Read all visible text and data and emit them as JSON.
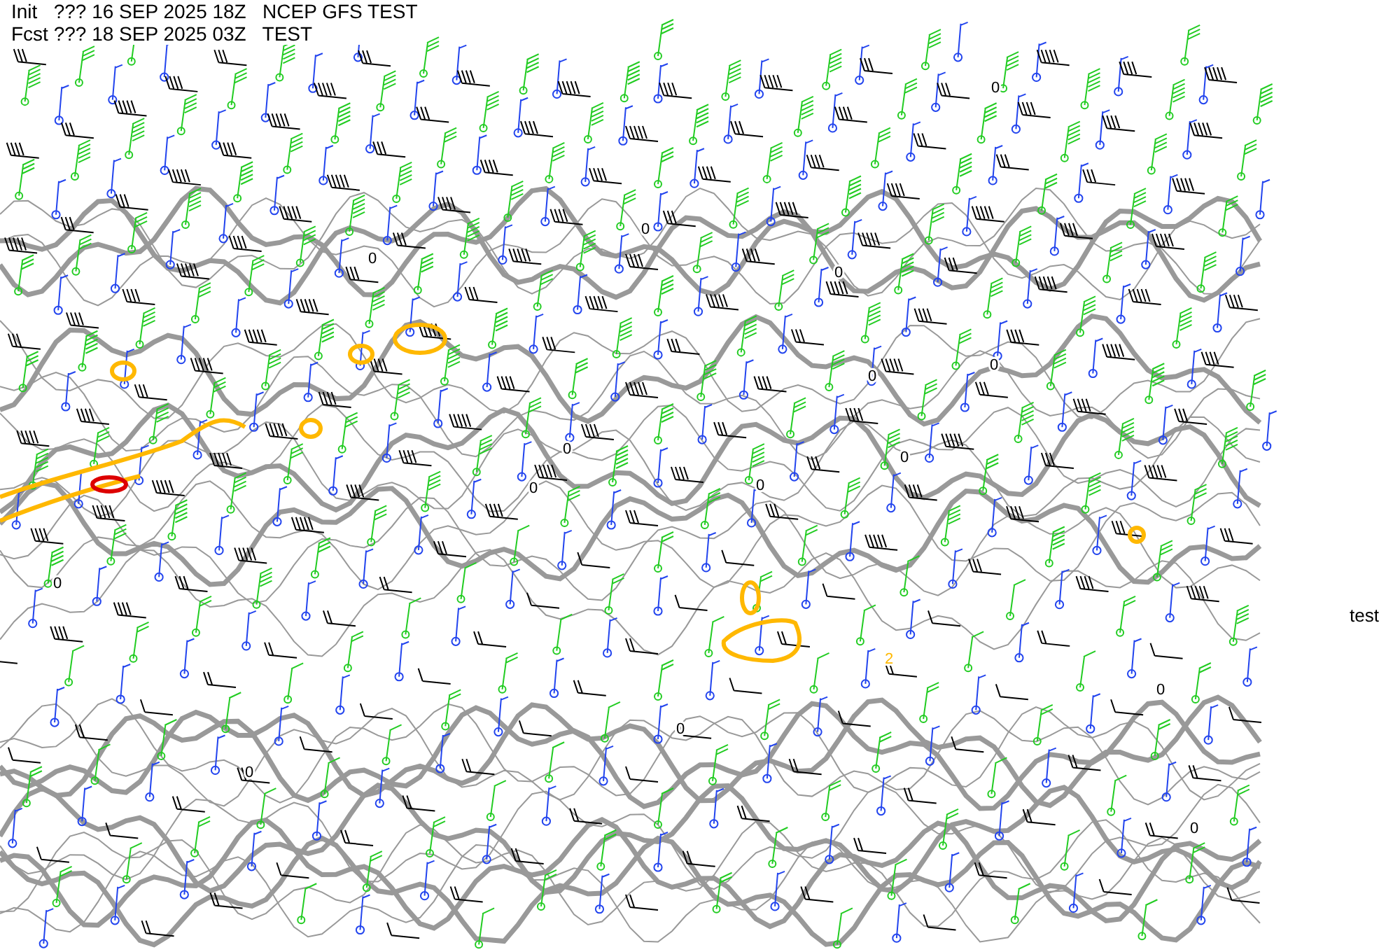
{
  "header": {
    "lines": [
      "Init   ??? 16 SEP 2025 18Z   NCEP GFS TEST",
      "Fcst ??? 18 SEP 2025 03Z   TEST"
    ]
  },
  "map": {
    "contour_labels": [
      "0",
      "0",
      "0",
      "0",
      "0",
      "0",
      "0",
      "0",
      "0",
      "0",
      "0",
      "2",
      "0",
      "0",
      "0",
      "0"
    ]
  },
  "side_label": "test"
}
